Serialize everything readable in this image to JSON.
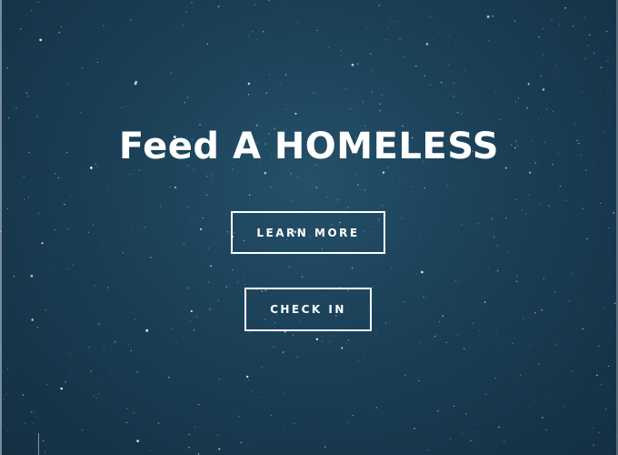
{
  "hero": {
    "headline": "Feed A HOMELESS",
    "learn_more_label": "LEARN MORE",
    "check_in_label": "CHECK IN"
  },
  "colors": {
    "background": "#1b3f56",
    "text": "#ffffff",
    "button_border": "#ffffff"
  }
}
